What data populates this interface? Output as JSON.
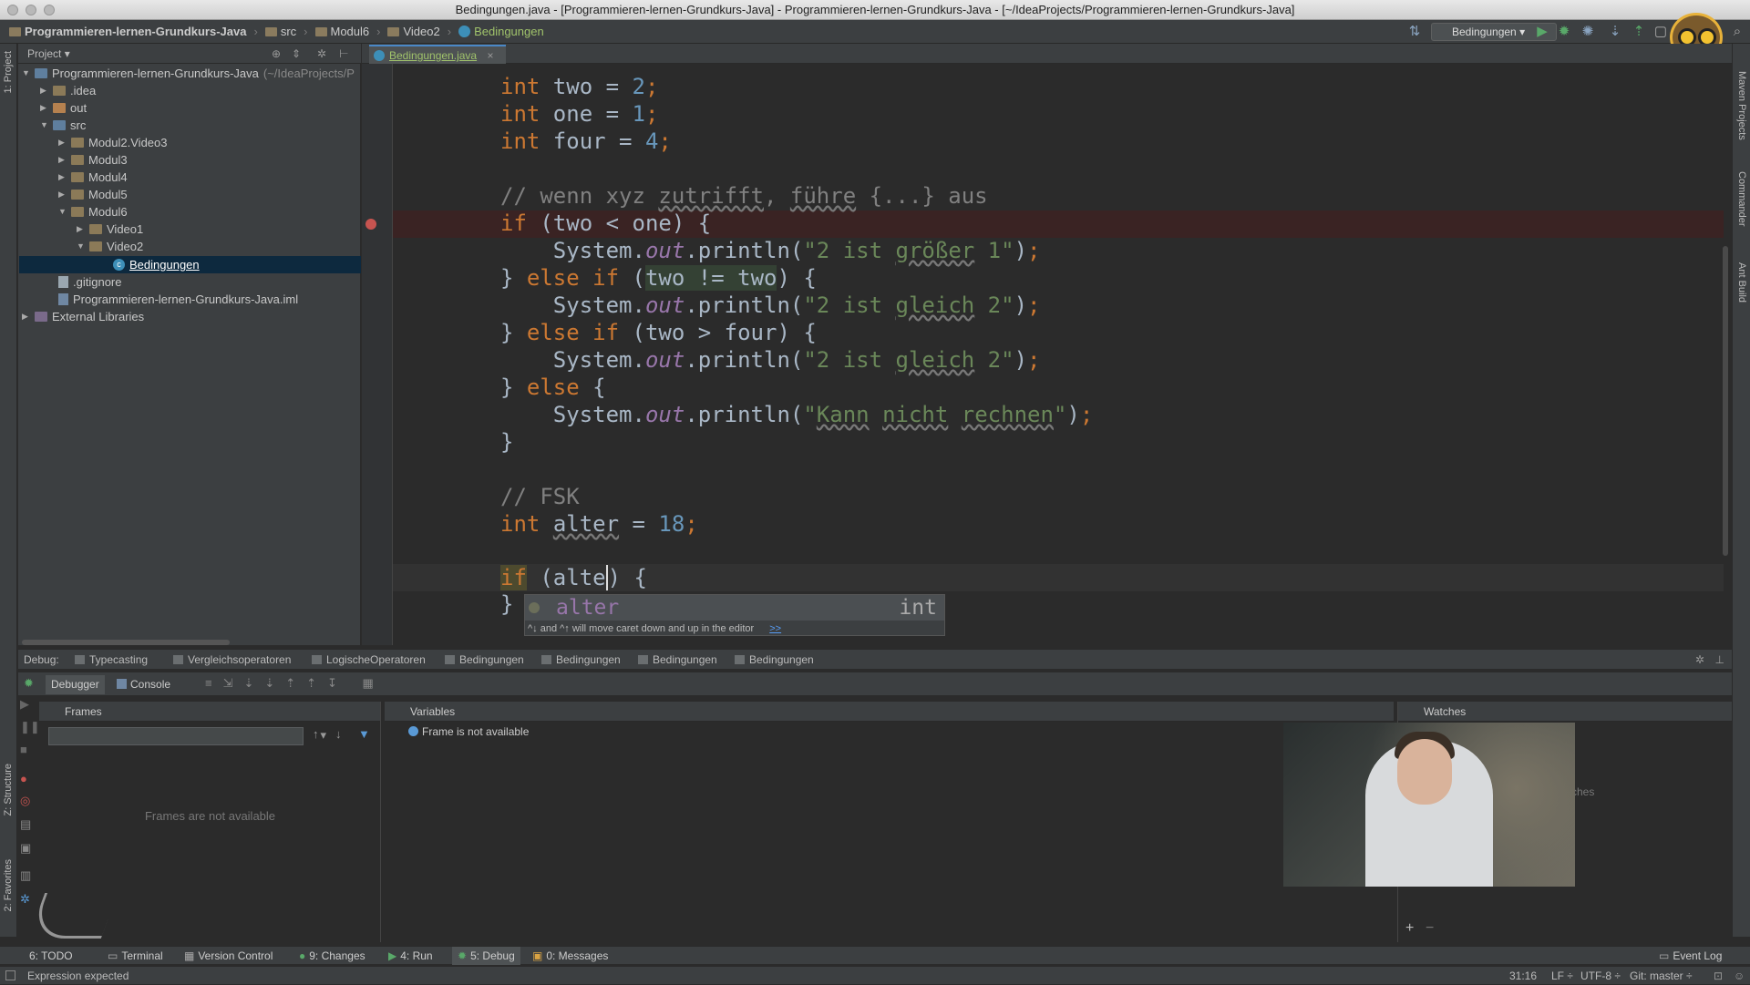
{
  "window": {
    "title": "Bedingungen.java - [Programmieren-lernen-Grundkurs-Java] - Programmieren-lernen-Grundkurs-Java - [~/IdeaProjects/Programmieren-lernen-Grundkurs-Java]"
  },
  "navbar": {
    "crumbs": [
      "Programmieren-lernen-Grundkurs-Java",
      "src",
      "Modul6",
      "Video2",
      "Bedingungen"
    ],
    "run_config": "Bedingungen"
  },
  "left_strip": {
    "project_tab": "1: Project",
    "structure_tab": "Z: Structure",
    "favorites_tab": "2: Favorites"
  },
  "right_strip": {
    "maven": "Maven Projects",
    "commander": "Commander",
    "ant": "Ant Build"
  },
  "project": {
    "header": "Project",
    "tree": [
      {
        "label": "Programmieren-lernen-Grundkurs-Java",
        "hint": "(~/IdeaProjects/P"
      },
      {
        "label": ".idea"
      },
      {
        "label": "out"
      },
      {
        "label": "src"
      },
      {
        "label": "Modul2.Video3"
      },
      {
        "label": "Modul3"
      },
      {
        "label": "Modul4"
      },
      {
        "label": "Modul5"
      },
      {
        "label": "Modul6"
      },
      {
        "label": "Video1"
      },
      {
        "label": "Video2"
      },
      {
        "label": "Bedingungen"
      },
      {
        "label": ".gitignore"
      },
      {
        "label": "Programmieren-lernen-Grundkurs-Java.iml"
      },
      {
        "label": "External Libraries"
      }
    ]
  },
  "editor": {
    "tab_label": "Bedingungen.java",
    "completion": {
      "item": "alter",
      "type": "int",
      "hint": "^↓ and ^↑ will move caret down and up in the editor",
      "hint_link": ">>"
    }
  },
  "debug": {
    "label": "Debug:",
    "tabs": [
      "Typecasting",
      "Vergleichsoperatoren",
      "LogischeOperatoren",
      "Bedingungen",
      "Bedingungen",
      "Bedingungen",
      "Bedingungen"
    ],
    "subtabs": {
      "debugger": "Debugger",
      "console": "Console"
    },
    "frames": {
      "title": "Frames",
      "empty": "Frames are not available"
    },
    "variables": {
      "title": "Variables",
      "message": "Frame is not available"
    },
    "watches": {
      "title": "Watches",
      "partial": "ches"
    }
  },
  "bottom_tabs": [
    {
      "label": "6: TODO"
    },
    {
      "label": "Terminal"
    },
    {
      "label": "Version Control"
    },
    {
      "label": "9: Changes"
    },
    {
      "label": "4: Run"
    },
    {
      "label": "5: Debug"
    },
    {
      "label": "0: Messages"
    }
  ],
  "event_log": "Event Log",
  "status": {
    "message": "Expression expected",
    "position": "31:16",
    "line_sep": "LF ÷",
    "encoding": "UTF-8 ÷",
    "git": "Git: master ÷"
  },
  "colors": {
    "keyword": "#cc7832",
    "number": "#6897bb",
    "string": "#6a8759",
    "comment": "#808080",
    "field": "#9876aa",
    "breakpoint": "#c75450"
  },
  "icons": [
    "close-icon",
    "minimize-icon",
    "zoom-icon",
    "folder-icon",
    "class-icon",
    "run-icon",
    "debug-icon",
    "breakpoint-icon",
    "gear-icon",
    "owl-logo-icon"
  ]
}
